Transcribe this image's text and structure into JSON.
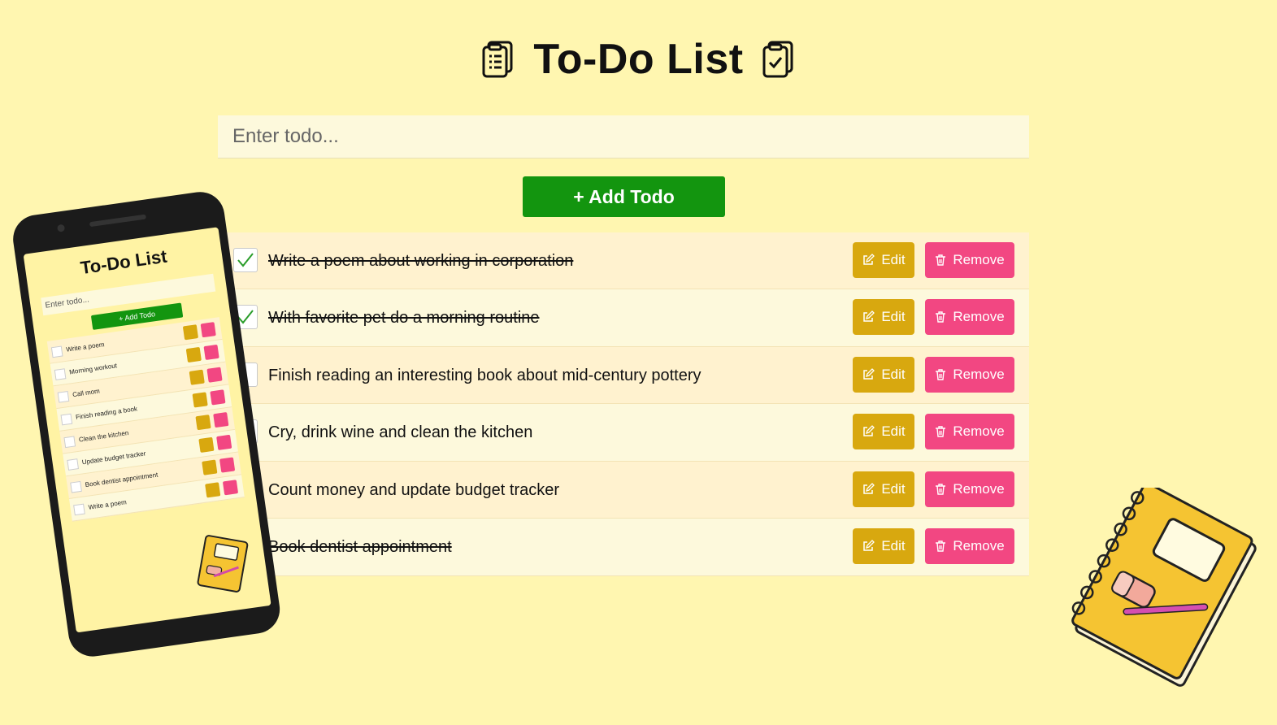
{
  "header": {
    "title": "To-Do List",
    "left_icon": "clipboard-list-icon",
    "right_icon": "clipboard-check-icon"
  },
  "input": {
    "placeholder": "Enter todo...",
    "value": ""
  },
  "add_button": {
    "label": "+ Add Todo"
  },
  "todos": [
    {
      "text": "Write a poem about working in corporation",
      "completed": true
    },
    {
      "text": "With favorite pet do a morning routine",
      "completed": true
    },
    {
      "text": "Finish reading an interesting book about mid-century pottery",
      "completed": false
    },
    {
      "text": "Cry, drink wine and clean the kitchen",
      "completed": false
    },
    {
      "text": "Count money and update budget tracker",
      "completed": false
    },
    {
      "text": "Book dentist appointment",
      "completed": true
    }
  ],
  "buttons": {
    "edit_label": "Edit",
    "remove_label": "Remove",
    "edit_icon": "pencil-square-icon",
    "remove_icon": "trash-icon"
  },
  "phone_preview": {
    "title": "To-Do List",
    "input_placeholder": "Enter todo...",
    "add_label": "+ Add Todo",
    "items": [
      "Write a poem",
      "Morning workout",
      "Call mom",
      "Finish reading a book",
      "Clean the kitchen",
      "Update budget tracker",
      "Book dentist appointment",
      "Write a poem"
    ]
  },
  "colors": {
    "background": "#fff6b0",
    "add_button": "#13950f",
    "edit_button": "#d8a80f",
    "remove_button": "#f24782",
    "row_odd": "#fff2cf",
    "row_even": "#fdf9dc",
    "check_mark": "#2a9d2a"
  }
}
